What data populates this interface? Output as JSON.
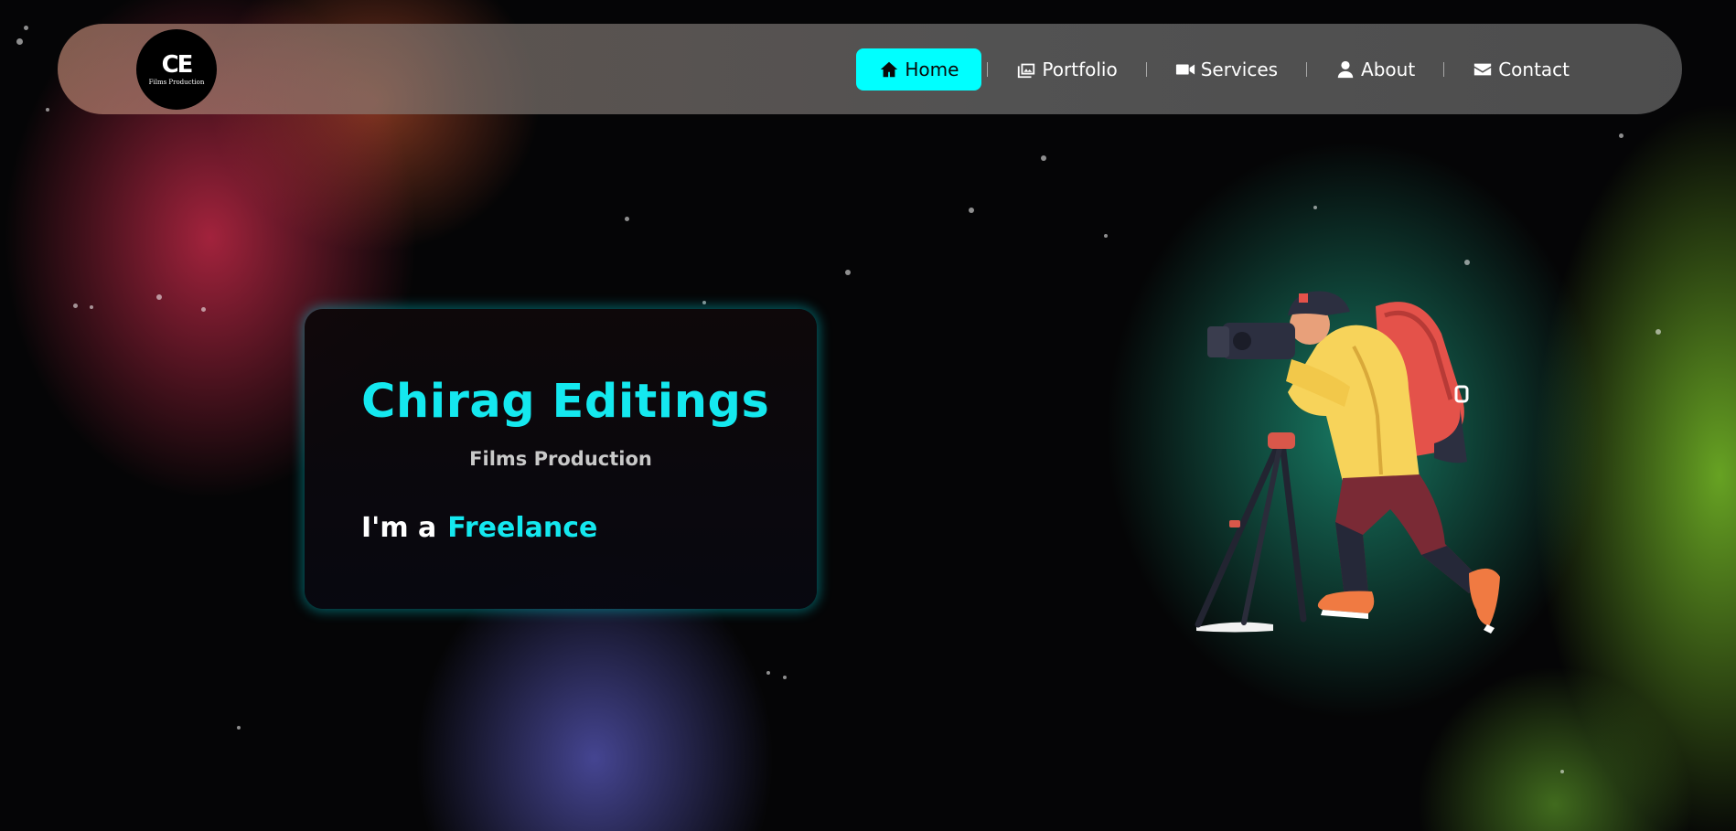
{
  "brand": {
    "logo_mark": "CE",
    "logo_text": "Films Production"
  },
  "nav": {
    "items": [
      {
        "label": "Home",
        "icon": "home-icon",
        "active": true
      },
      {
        "label": "Portfolio",
        "icon": "images-icon",
        "active": false
      },
      {
        "label": "Services",
        "icon": "video-camera-icon",
        "active": false
      },
      {
        "label": "About",
        "icon": "user-icon",
        "active": false
      },
      {
        "label": "Contact",
        "icon": "envelope-icon",
        "active": false
      }
    ]
  },
  "hero": {
    "title": "Chirag Editings",
    "subtitle": "Films Production",
    "role_prefix": "I'm a",
    "role_word": "Freelance"
  },
  "colors": {
    "accent": "#00ffff",
    "title": "#14e8ef",
    "background": "#050506"
  }
}
